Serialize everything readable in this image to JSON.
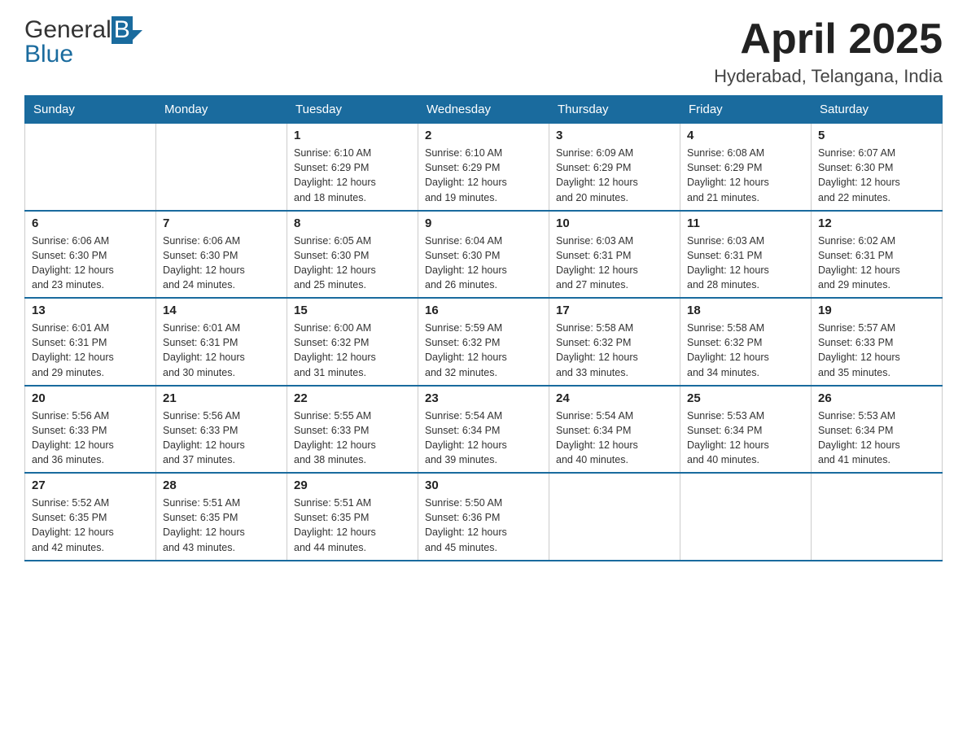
{
  "header": {
    "logo_general": "General",
    "logo_blue": "Blue",
    "title": "April 2025",
    "subtitle": "Hyderabad, Telangana, India"
  },
  "calendar": {
    "days_of_week": [
      "Sunday",
      "Monday",
      "Tuesday",
      "Wednesday",
      "Thursday",
      "Friday",
      "Saturday"
    ],
    "weeks": [
      [
        {
          "num": "",
          "info": ""
        },
        {
          "num": "",
          "info": ""
        },
        {
          "num": "1",
          "info": "Sunrise: 6:10 AM\nSunset: 6:29 PM\nDaylight: 12 hours\nand 18 minutes."
        },
        {
          "num": "2",
          "info": "Sunrise: 6:10 AM\nSunset: 6:29 PM\nDaylight: 12 hours\nand 19 minutes."
        },
        {
          "num": "3",
          "info": "Sunrise: 6:09 AM\nSunset: 6:29 PM\nDaylight: 12 hours\nand 20 minutes."
        },
        {
          "num": "4",
          "info": "Sunrise: 6:08 AM\nSunset: 6:29 PM\nDaylight: 12 hours\nand 21 minutes."
        },
        {
          "num": "5",
          "info": "Sunrise: 6:07 AM\nSunset: 6:30 PM\nDaylight: 12 hours\nand 22 minutes."
        }
      ],
      [
        {
          "num": "6",
          "info": "Sunrise: 6:06 AM\nSunset: 6:30 PM\nDaylight: 12 hours\nand 23 minutes."
        },
        {
          "num": "7",
          "info": "Sunrise: 6:06 AM\nSunset: 6:30 PM\nDaylight: 12 hours\nand 24 minutes."
        },
        {
          "num": "8",
          "info": "Sunrise: 6:05 AM\nSunset: 6:30 PM\nDaylight: 12 hours\nand 25 minutes."
        },
        {
          "num": "9",
          "info": "Sunrise: 6:04 AM\nSunset: 6:30 PM\nDaylight: 12 hours\nand 26 minutes."
        },
        {
          "num": "10",
          "info": "Sunrise: 6:03 AM\nSunset: 6:31 PM\nDaylight: 12 hours\nand 27 minutes."
        },
        {
          "num": "11",
          "info": "Sunrise: 6:03 AM\nSunset: 6:31 PM\nDaylight: 12 hours\nand 28 minutes."
        },
        {
          "num": "12",
          "info": "Sunrise: 6:02 AM\nSunset: 6:31 PM\nDaylight: 12 hours\nand 29 minutes."
        }
      ],
      [
        {
          "num": "13",
          "info": "Sunrise: 6:01 AM\nSunset: 6:31 PM\nDaylight: 12 hours\nand 29 minutes."
        },
        {
          "num": "14",
          "info": "Sunrise: 6:01 AM\nSunset: 6:31 PM\nDaylight: 12 hours\nand 30 minutes."
        },
        {
          "num": "15",
          "info": "Sunrise: 6:00 AM\nSunset: 6:32 PM\nDaylight: 12 hours\nand 31 minutes."
        },
        {
          "num": "16",
          "info": "Sunrise: 5:59 AM\nSunset: 6:32 PM\nDaylight: 12 hours\nand 32 minutes."
        },
        {
          "num": "17",
          "info": "Sunrise: 5:58 AM\nSunset: 6:32 PM\nDaylight: 12 hours\nand 33 minutes."
        },
        {
          "num": "18",
          "info": "Sunrise: 5:58 AM\nSunset: 6:32 PM\nDaylight: 12 hours\nand 34 minutes."
        },
        {
          "num": "19",
          "info": "Sunrise: 5:57 AM\nSunset: 6:33 PM\nDaylight: 12 hours\nand 35 minutes."
        }
      ],
      [
        {
          "num": "20",
          "info": "Sunrise: 5:56 AM\nSunset: 6:33 PM\nDaylight: 12 hours\nand 36 minutes."
        },
        {
          "num": "21",
          "info": "Sunrise: 5:56 AM\nSunset: 6:33 PM\nDaylight: 12 hours\nand 37 minutes."
        },
        {
          "num": "22",
          "info": "Sunrise: 5:55 AM\nSunset: 6:33 PM\nDaylight: 12 hours\nand 38 minutes."
        },
        {
          "num": "23",
          "info": "Sunrise: 5:54 AM\nSunset: 6:34 PM\nDaylight: 12 hours\nand 39 minutes."
        },
        {
          "num": "24",
          "info": "Sunrise: 5:54 AM\nSunset: 6:34 PM\nDaylight: 12 hours\nand 40 minutes."
        },
        {
          "num": "25",
          "info": "Sunrise: 5:53 AM\nSunset: 6:34 PM\nDaylight: 12 hours\nand 40 minutes."
        },
        {
          "num": "26",
          "info": "Sunrise: 5:53 AM\nSunset: 6:34 PM\nDaylight: 12 hours\nand 41 minutes."
        }
      ],
      [
        {
          "num": "27",
          "info": "Sunrise: 5:52 AM\nSunset: 6:35 PM\nDaylight: 12 hours\nand 42 minutes."
        },
        {
          "num": "28",
          "info": "Sunrise: 5:51 AM\nSunset: 6:35 PM\nDaylight: 12 hours\nand 43 minutes."
        },
        {
          "num": "29",
          "info": "Sunrise: 5:51 AM\nSunset: 6:35 PM\nDaylight: 12 hours\nand 44 minutes."
        },
        {
          "num": "30",
          "info": "Sunrise: 5:50 AM\nSunset: 6:36 PM\nDaylight: 12 hours\nand 45 minutes."
        },
        {
          "num": "",
          "info": ""
        },
        {
          "num": "",
          "info": ""
        },
        {
          "num": "",
          "info": ""
        }
      ]
    ]
  }
}
